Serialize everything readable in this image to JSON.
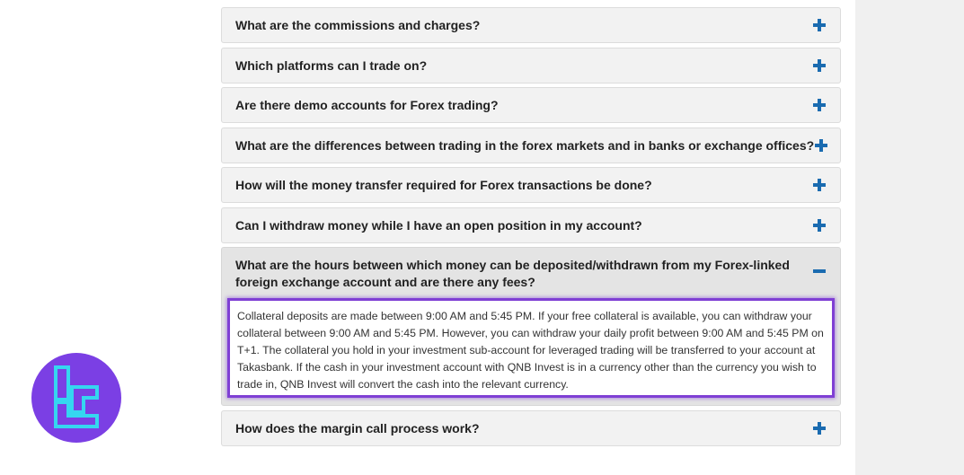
{
  "faq": {
    "items": [
      {
        "question": "What are the commissions and charges?",
        "icon": "plus-icon"
      },
      {
        "question": "Which platforms can I trade on?",
        "icon": "plus-icon"
      },
      {
        "question": "Are there demo accounts for Forex trading?",
        "icon": "plus-icon"
      },
      {
        "question": "What are the differences between trading in the forex markets and in banks or exchange offices?",
        "icon": "plus-icon"
      },
      {
        "question": "How will the money transfer required for Forex transactions be done?",
        "icon": "plus-icon"
      },
      {
        "question": "Can I withdraw money while I have an open position in my account?",
        "icon": "plus-icon"
      },
      {
        "question": "What are the hours between which money can be deposited/withdrawn from my Forex-linked foreign exchange account and are there any fees?",
        "icon": "minus-icon",
        "answer": "Collateral deposits are made between 9:00 AM and 5:45 PM. If your free collateral is available, you can withdraw your collateral between 9:00 AM and 5:45 PM. However, you can withdraw your daily profit between 9:00 AM and 5:45 PM on T+1. The collateral you hold in your investment sub-account for leveraged trading will be transferred to your account at Takasbank. If the cash in your investment account with QNB Invest is in a currency other than the currency you wish to trade in, QNB Invest will convert the cash into the relevant currency."
      },
      {
        "question": "How does the margin call process work?",
        "icon": "plus-icon"
      }
    ]
  },
  "colors": {
    "accent": "#1a6bb0",
    "highlight": "#7f3fd4",
    "logo_bg": "#7b3fe4",
    "logo_mark": "#35d6f0"
  },
  "logo": {
    "icon": "brand-logo-icon"
  }
}
